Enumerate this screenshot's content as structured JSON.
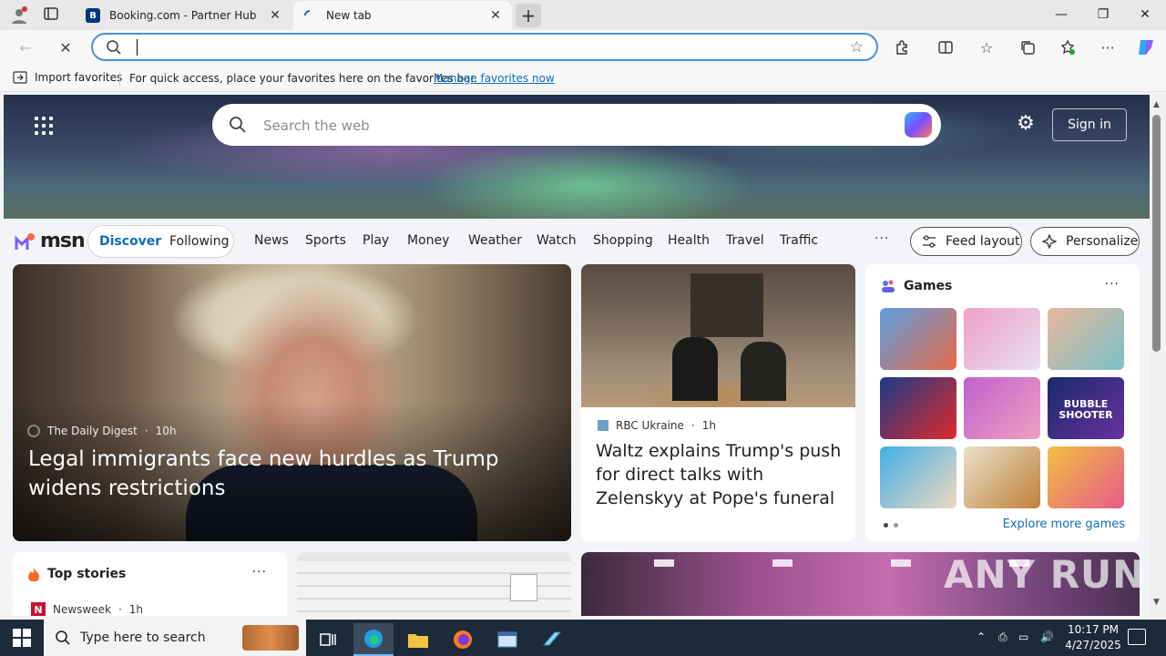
{
  "browser": {
    "tabs": [
      {
        "title": "Booking.com - Partner Hub",
        "favicon": "B",
        "favicon_color": "#003580"
      },
      {
        "title": "New tab"
      }
    ],
    "new_tab_label": "+",
    "address": {
      "value": "",
      "placeholder": ""
    },
    "favorites_bar": {
      "import_label": "Import favorites",
      "message": "For quick access, place your favorites here on the favorites bar.",
      "link": "Manage favorites now"
    }
  },
  "msn": {
    "search_placeholder": "Search the web",
    "sign_in": "Sign in",
    "logo_text": "msn",
    "feed_tabs": {
      "discover": "Discover",
      "following": "Following"
    },
    "nav": [
      "News",
      "Sports",
      "Play",
      "Money",
      "Weather",
      "Watch",
      "Shopping",
      "Health",
      "Travel",
      "Traffic"
    ],
    "more": "···",
    "feed_layout": "Feed layout",
    "personalize": "Personalize",
    "hero": {
      "source": "The Daily Digest",
      "age": "10h",
      "headline": "Legal immigrants face new hurdles as Trump widens restrictions"
    },
    "news": {
      "source": "RBC Ukraine",
      "age": "1h",
      "headline": "Waltz explains Trump's push for direct talks with Zelenskyy at Pope's funeral"
    },
    "games": {
      "title": "Games",
      "explore": "Explore more games",
      "tiles": [
        {
          "name": "game-tile-1",
          "colors": [
            "#5a9ee0",
            "#e86a4a"
          ]
        },
        {
          "name": "game-tile-2",
          "colors": [
            "#f0a0c8",
            "#e8e0f0"
          ]
        },
        {
          "name": "game-tile-3",
          "colors": [
            "#e8b89a",
            "#7ac0c8"
          ]
        },
        {
          "name": "game-tile-4",
          "colors": [
            "#1a3a8a",
            "#e02a2a"
          ]
        },
        {
          "name": "game-tile-5",
          "colors": [
            "#c060d0",
            "#f0a0c0"
          ]
        },
        {
          "name": "game-tile-6",
          "colors": [
            "#1a2a6a",
            "#6a30a0"
          ],
          "label": "BUBBLE SHOOTER"
        },
        {
          "name": "game-tile-7",
          "colors": [
            "#40b0e8",
            "#f0d8c0"
          ]
        },
        {
          "name": "game-tile-8",
          "colors": [
            "#e8e0c8",
            "#c0803a"
          ]
        },
        {
          "name": "game-tile-9",
          "colors": [
            "#f0c040",
            "#e85a8a"
          ]
        }
      ]
    },
    "top_stories": {
      "title": "Top stories",
      "source": "Newsweek",
      "age": "1h",
      "source_icon": "N"
    }
  },
  "watermark": "ANY RUN",
  "taskbar": {
    "search_placeholder": "Type here to search",
    "time": "10:17 PM",
    "date": "4/27/2025"
  }
}
